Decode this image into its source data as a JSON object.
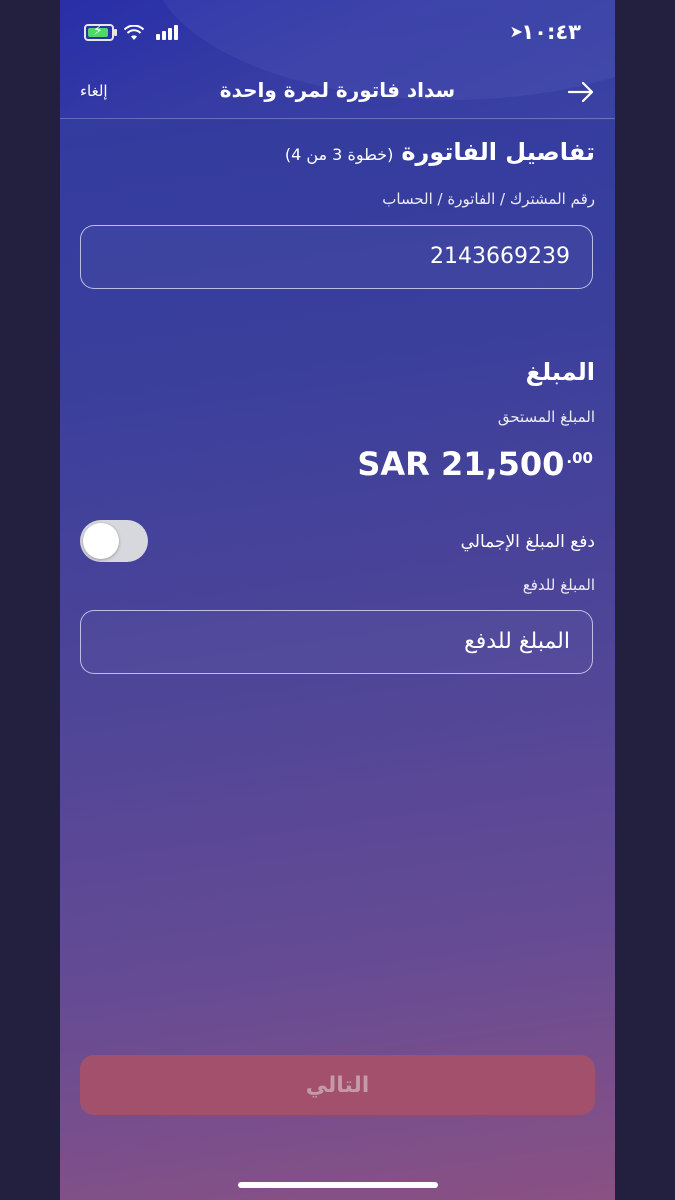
{
  "status_bar": {
    "time": "١٠:٤٣",
    "location_icon": "location-arrow-icon",
    "wifi_icon": "wifi-icon",
    "signal_icon": "signal-icon",
    "battery_icon": "battery-charging-icon"
  },
  "header": {
    "cancel_label": "إلغاء",
    "title": "سداد فاتورة لمرة واحدة",
    "back_icon": "arrow-right-icon"
  },
  "bill_details": {
    "title": "تفاصيل الفاتورة",
    "step_note": "(خطوة 3 من 4)",
    "account_label": "رقم المشترك / الفاتورة / الحساب",
    "account_value": "2143669239"
  },
  "amount_section": {
    "title": "المبلغ",
    "due_label": "المبلغ المستحق",
    "due_amount": "SAR 21,500",
    "due_decimals": ".00",
    "pay_total_label": "دفع المبلغ الإجمالي",
    "pay_total_toggle_on": false,
    "pay_amount_label": "المبلغ للدفع",
    "pay_amount_placeholder": "المبلغ للدفع"
  },
  "footer": {
    "next_label": "التالي"
  },
  "colors": {
    "next_button_disabled": "#a3506d",
    "toggle_off": "#d7d7de"
  }
}
